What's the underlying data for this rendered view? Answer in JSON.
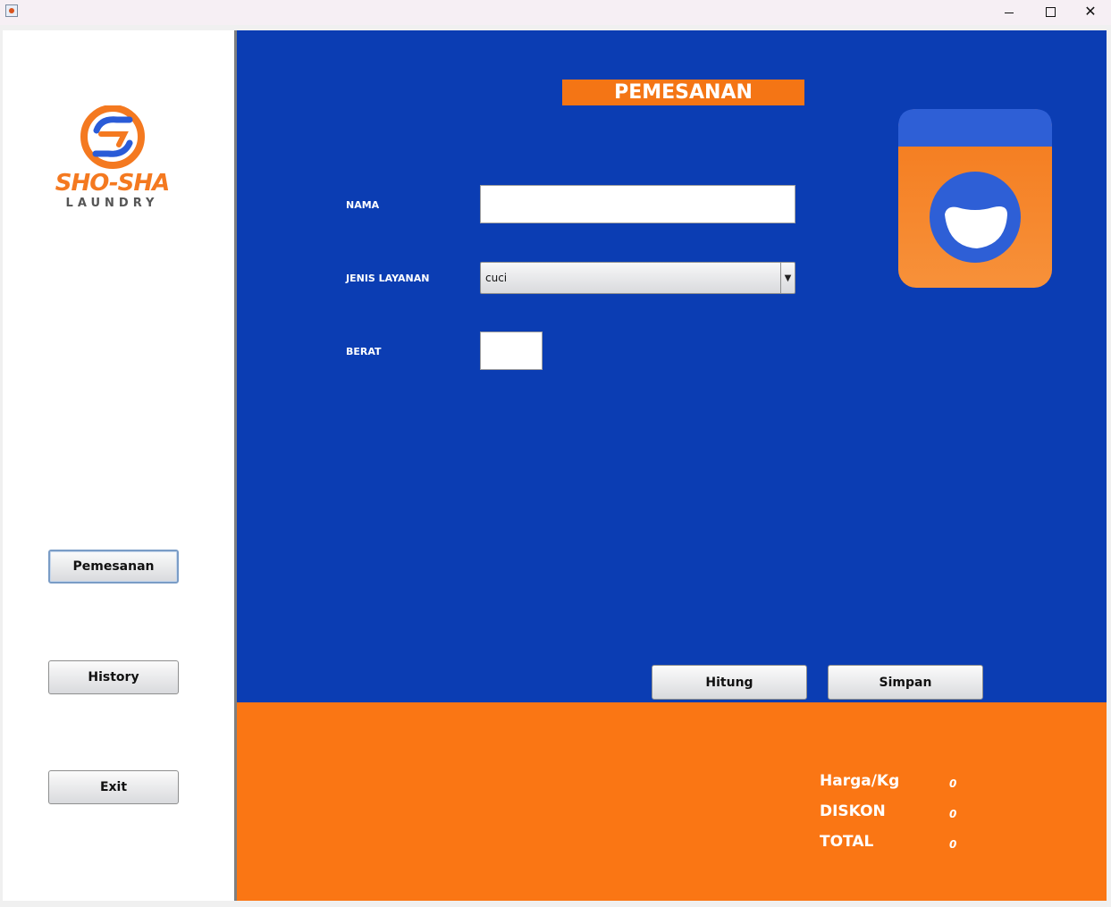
{
  "window": {
    "icon": "java-cup-icon",
    "controls": {
      "minimize": "minimize-icon",
      "maximize": "maximize-icon",
      "close": "close-icon"
    }
  },
  "sidebar": {
    "logo": {
      "name": "SHO-SHA",
      "tagline": "LAUNDRY"
    },
    "buttons": [
      {
        "label": "Pemesanan",
        "active": true
      },
      {
        "label": "History",
        "active": false
      },
      {
        "label": "Exit",
        "active": false
      }
    ]
  },
  "form": {
    "title": "PEMESANAN",
    "nama_label": "NAMA",
    "nama_value": "",
    "layanan_label": "JENIS LAYANAN",
    "layanan_value": "cuci",
    "berat_label": "BERAT",
    "berat_value": "",
    "hitung_label": "Hitung",
    "simpan_label": "Simpan"
  },
  "results": {
    "harga_label": "Harga/Kg",
    "harga_value": "0",
    "diskon_label": "DISKON",
    "diskon_value": "0",
    "total_label": "TOTAL",
    "total_value": "0"
  },
  "colors": {
    "main_bg": "#0b3db3",
    "accent_orange": "#f47515",
    "bottom_bg": "#fa7614"
  }
}
